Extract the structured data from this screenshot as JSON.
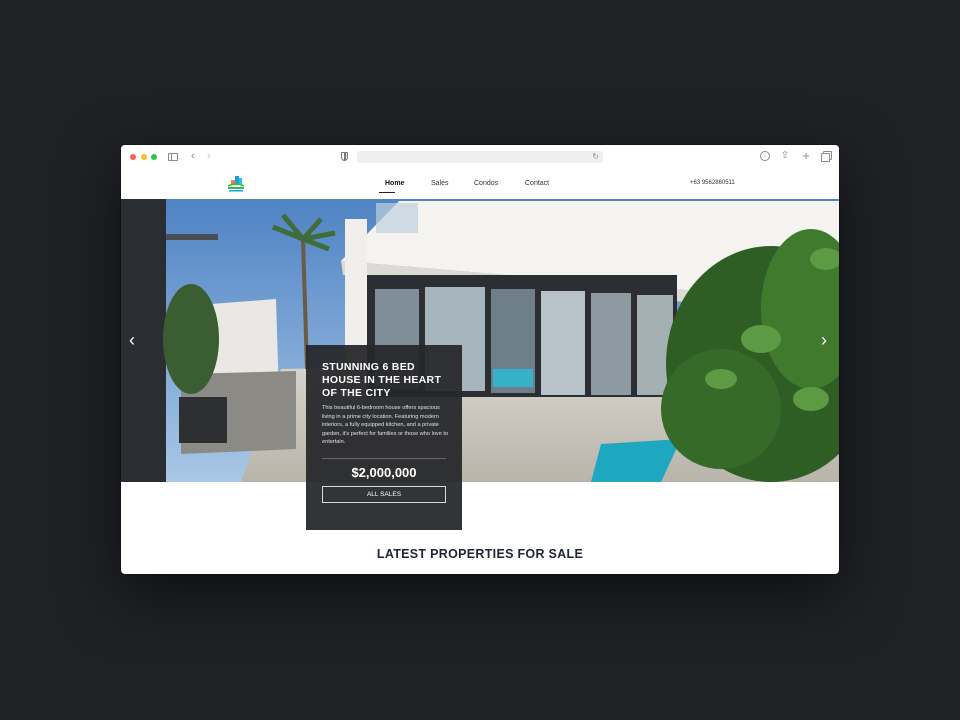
{
  "browser": {
    "icons": {
      "sidebar": "sidebar-icon",
      "back": "chevron-left-icon",
      "forward": "chevron-right-icon",
      "privacy": "shield-icon",
      "reload": "reload-icon",
      "download": "download-icon",
      "share": "share-icon",
      "new_tab": "plus-icon",
      "tabs": "tabs-overview-icon"
    }
  },
  "site": {
    "nav": [
      {
        "label": "Home",
        "active": true
      },
      {
        "label": "Sales"
      },
      {
        "label": "Condos"
      },
      {
        "label": "Contact"
      }
    ],
    "phone": "+63 9562860511"
  },
  "hero": {
    "prev_icon": "‹",
    "next_icon": "›",
    "card": {
      "title": "STUNNING 6 BED HOUSE IN THE HEART OF THE CITY",
      "description": "This beautiful 6-bedroom house offers spacious living in a prime city location. Featuring modern interiors, a fully equipped kitchen, and a private garden, it's perfect for families or those who love to entertain.",
      "price": "$2,000,000",
      "button_label": "ALL SALES"
    }
  },
  "latest": {
    "title": "LATEST PROPERTIES FOR SALE"
  },
  "colors": {
    "page_background": "#1f2125",
    "card_background": "#26272a",
    "heading": "#1e2536",
    "sky": "#5f8fc8"
  }
}
